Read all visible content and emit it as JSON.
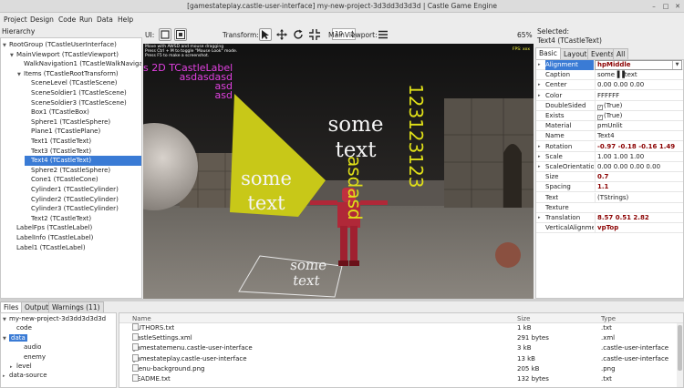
{
  "window": {
    "title": "[gamestateplay.castle-user-interface] my-new-project-3d3dd3d3d3d | Castle Game Engine",
    "controls": [
      "–",
      "□",
      "✕"
    ]
  },
  "menu": [
    "Project",
    "Design",
    "Code",
    "Run",
    "Data",
    "Help"
  ],
  "hierarchy": {
    "header": "Hierarchy",
    "items": [
      {
        "label": "RootGroup (TCastleUserInterface)",
        "tog": "▼"
      },
      {
        "label": "MainViewport (TCastleViewport)",
        "tog": "▼"
      },
      {
        "label": "WalkNavigation1 (TCastleWalkNavigat",
        "tog": ""
      },
      {
        "label": "Items (TCastleRootTransform)",
        "tog": "▼"
      },
      {
        "label": "SceneLevel (TCastleScene)",
        "tog": ""
      },
      {
        "label": "SceneSoldier1 (TCastleScene)",
        "tog": ""
      },
      {
        "label": "SceneSoldier3 (TCastleScene)",
        "tog": ""
      },
      {
        "label": "Box1 (TCastleBox)",
        "tog": ""
      },
      {
        "label": "Sphere1 (TCastleSphere)",
        "tog": ""
      },
      {
        "label": "Plane1 (TCastlePlane)",
        "tog": ""
      },
      {
        "label": "Text1 (TCastleText)",
        "tog": ""
      },
      {
        "label": "Text3 (TCastleText)",
        "tog": ""
      },
      {
        "label": "Text4 (TCastleText)",
        "tog": ""
      },
      {
        "label": "Sphere2 (TCastleSphere)",
        "tog": ""
      },
      {
        "label": "Cone1 (TCastleCone)",
        "tog": ""
      },
      {
        "label": "Cylinder1 (TCastleCylinder)",
        "tog": ""
      },
      {
        "label": "Cylinder2 (TCastleCylinder)",
        "tog": ""
      },
      {
        "label": "Cylinder3 (TCastleCylinder)",
        "tog": ""
      },
      {
        "label": "Text2 (TCastleText)",
        "tog": ""
      },
      {
        "label": "LabelFps (TCastleLabel)",
        "tog": ""
      },
      {
        "label": "LabelInfo (TCastleLabel)",
        "tog": ""
      },
      {
        "label": "Label1 (TCastleLabel)",
        "tog": ""
      }
    ],
    "selected_index": 12
  },
  "toolbar": {
    "ui_label": "UI:",
    "spin_value": "10",
    "transform_label": "Transform:",
    "main_viewport_label": "MainViewport:",
    "zoom": "65%"
  },
  "viewport": {
    "help_lines": [
      "Move with AWSD and mouse dragging",
      "Press Ctrl + M to toggle \"Mouse Look\" mode.",
      "Press F5 to make a screenshot."
    ],
    "fps": "FPS: xxx",
    "label_2d": "s 2D TCastleLabel",
    "label_lines": [
      "asdasdasd",
      "asd",
      "asd"
    ],
    "text_some": "some",
    "text_text": "text",
    "vertical_1": "asdasd",
    "vertical_2": "123123123",
    "colors": {
      "pink": "#e040e0",
      "yellow": "#e0e018",
      "white": "#ffffff"
    }
  },
  "props": {
    "selected_label": "Selected:",
    "selected_value": "Text4 (TCastleText)",
    "tabs": [
      "Basic",
      "Layout",
      "Events",
      "All"
    ],
    "active_tab": 0,
    "rows": [
      {
        "name": "Alignment",
        "value": "hpMiddle",
        "bold": true,
        "exp": "▸",
        "selected": true
      },
      {
        "name": "Caption",
        "value": "some▐▐text",
        "bold": false,
        "exp": ""
      },
      {
        "name": "Center",
        "value": "0.00 0.00 0.00",
        "bold": false,
        "exp": "▸"
      },
      {
        "name": "Color",
        "value": "FFFFFF",
        "bold": false,
        "exp": "▸"
      },
      {
        "name": "DoubleSided",
        "value": "(True)",
        "bold": false,
        "exp": "",
        "check": true
      },
      {
        "name": "Exists",
        "value": "(True)",
        "bold": false,
        "exp": "",
        "check": true
      },
      {
        "name": "Material",
        "value": "pmUnlit",
        "bold": false,
        "exp": ""
      },
      {
        "name": "Name",
        "value": "Text4",
        "bold": false,
        "exp": ""
      },
      {
        "name": "Rotation",
        "value": "-0.97 -0.18 -0.16 1.49",
        "bold": true,
        "exp": "▸"
      },
      {
        "name": "Scale",
        "value": "1.00 1.00 1.00",
        "bold": false,
        "exp": "▸"
      },
      {
        "name": "ScaleOrientatio",
        "value": "0.00 0.00 0.00 0.00",
        "bold": false,
        "exp": "▸"
      },
      {
        "name": "Size",
        "value": "0.7",
        "bold": true,
        "exp": ""
      },
      {
        "name": "Spacing",
        "value": "1.1",
        "bold": true,
        "exp": ""
      },
      {
        "name": "Text",
        "value": "(TStrings)",
        "bold": false,
        "exp": ""
      },
      {
        "name": "Texture",
        "value": "",
        "bold": false,
        "exp": ""
      },
      {
        "name": "Translation",
        "value": "8.57 0.51 2.82",
        "bold": true,
        "exp": "▸"
      },
      {
        "name": "VerticalAlignme",
        "value": "vpTop",
        "bold": true,
        "exp": ""
      }
    ]
  },
  "bottom": {
    "tabs": [
      "Files",
      "Output",
      "Warnings (11)"
    ],
    "active_tab": 0,
    "tree": [
      {
        "label": "my-new-project-3d3dd3d3d3d",
        "tog": "▼",
        "folder": false
      },
      {
        "label": "code",
        "tog": "",
        "folder": true
      },
      {
        "label": "data",
        "tog": "▼",
        "folder": true,
        "selected": true
      },
      {
        "label": "audio",
        "tog": "",
        "folder": true
      },
      {
        "label": "enemy",
        "tog": "",
        "folder": true
      },
      {
        "label": "level",
        "tog": "▸",
        "folder": true
      },
      {
        "label": "data-source",
        "tog": "▸",
        "folder": true
      }
    ],
    "columns": [
      "Name",
      "Size",
      "Type"
    ],
    "files": [
      {
        "name": "AUTHORS.txt",
        "size": "1 kB",
        "type": ".txt"
      },
      {
        "name": "CastleSettings.xml",
        "size": "291 bytes",
        "type": ".xml"
      },
      {
        "name": "gamestatemenu.castle-user-interface",
        "size": "3 kB",
        "type": ".castle-user-interface"
      },
      {
        "name": "gamestateplay.castle-user-interface",
        "size": "13 kB",
        "type": ".castle-user-interface"
      },
      {
        "name": "menu-background.png",
        "size": "205 kB",
        "type": ".png"
      },
      {
        "name": "README.txt",
        "size": "132 bytes",
        "type": ".txt"
      }
    ]
  }
}
